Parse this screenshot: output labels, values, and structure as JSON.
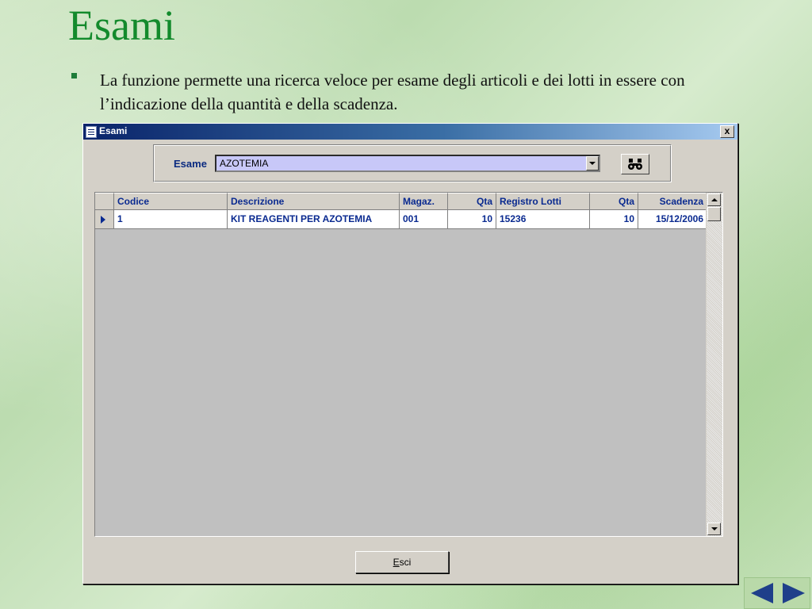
{
  "slide": {
    "title": "Esami",
    "bullet": "La funzione permette una ricerca veloce per esame degli articoli e dei lotti in essere con l’indicazione della quantità e della scadenza."
  },
  "window": {
    "title": "Esami",
    "close_label": "x"
  },
  "search": {
    "label": "Esame",
    "value": "AZOTEMIA",
    "find_icon": "binoculars-icon"
  },
  "grid": {
    "columns": [
      "Codice",
      "Descrizione",
      "Magaz.",
      "Qta",
      "Registro Lotti",
      "Qta",
      "Scadenza"
    ],
    "rows": [
      [
        "1",
        "KIT REAGENTI PER AZOTEMIA",
        "001",
        "10",
        "15236",
        "10",
        "15/12/2006"
      ]
    ]
  },
  "footer": {
    "exit_underlined": "E",
    "exit_rest": "sci"
  },
  "colors": {
    "title_green": "#138a2c",
    "titlebar_blue": "#0a246a",
    "grid_text_blue": "#0a2a90",
    "combo_bg": "#c8c8f8"
  }
}
